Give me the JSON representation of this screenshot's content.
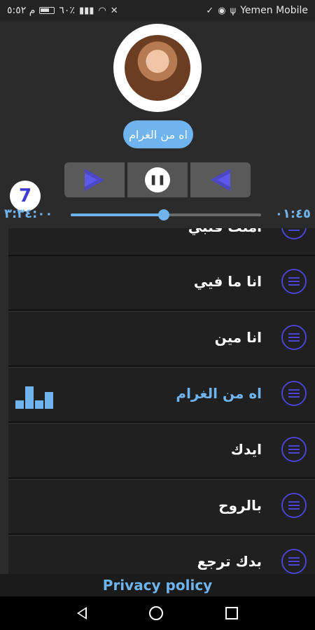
{
  "status_bar": {
    "time": "م ٥:٥٢",
    "battery": "٦٠٪",
    "carrier": "Yemen Mobile"
  },
  "player": {
    "current_song": "اه من الغرام",
    "badge_text": "7",
    "elapsed": "٠١:٤٥",
    "duration": "٣:٣٤:٠٠",
    "progress": 0.49
  },
  "songs": [
    {
      "title": "امنت قلبي",
      "active": false
    },
    {
      "title": "انا ما فيي",
      "active": false
    },
    {
      "title": "انا مين",
      "active": false
    },
    {
      "title": "اه من الغرام",
      "active": true
    },
    {
      "title": "ايدك",
      "active": false
    },
    {
      "title": "بالروح",
      "active": false
    },
    {
      "title": "بدك ترجع",
      "active": false
    }
  ],
  "footer": {
    "privacy_label": "Privacy policy"
  },
  "colors": {
    "accent": "#6fb4ee",
    "menu_icon": "#4b44d6"
  }
}
